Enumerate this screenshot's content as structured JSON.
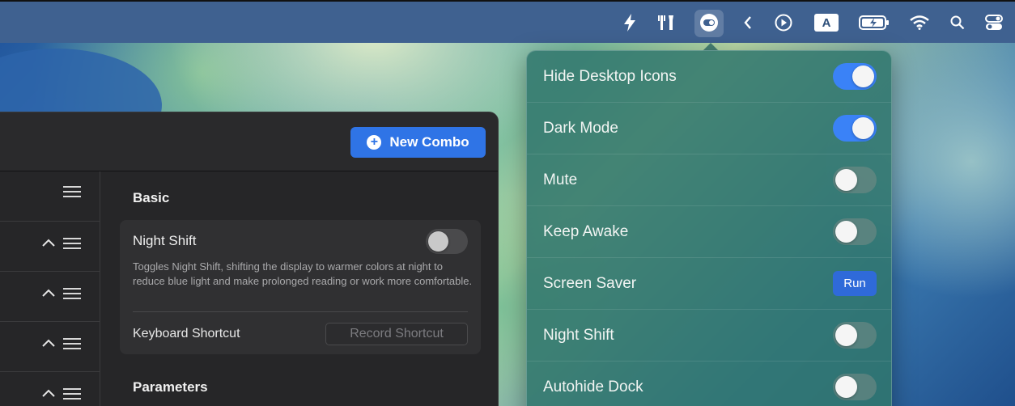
{
  "menubar": {
    "icons": [
      "bolt-icon",
      "tools-icon",
      "toggle-icon",
      "chevron-left-icon",
      "play-circle-icon",
      "input-source-icon",
      "battery-icon",
      "wifi-icon",
      "search-icon",
      "control-center-icon"
    ],
    "input_source_letter": "A"
  },
  "dropdown": {
    "items": [
      {
        "label": "Hide Desktop Icons",
        "control": "toggle",
        "on": true
      },
      {
        "label": "Dark Mode",
        "control": "toggle",
        "on": true
      },
      {
        "label": "Mute",
        "control": "toggle",
        "on": false
      },
      {
        "label": "Keep Awake",
        "control": "toggle",
        "on": false
      },
      {
        "label": "Screen Saver",
        "control": "button",
        "button_label": "Run"
      },
      {
        "label": "Night Shift",
        "control": "toggle",
        "on": false
      },
      {
        "label": "Autohide Dock",
        "control": "toggle",
        "on": false
      }
    ]
  },
  "window": {
    "new_combo_label": "New Combo",
    "basic_title": "Basic",
    "card": {
      "title": "Night Shift",
      "toggle_on": false,
      "description": "Toggles Night Shift, shifting the display to warmer colors at night to reduce blue light and make prolonged reading or work more comfortable.",
      "shortcut_label": "Keyboard Shortcut",
      "record_label": "Record Shortcut"
    },
    "parameters_title": "Parameters"
  },
  "colors": {
    "accent": "#3a82f7",
    "button_blue": "#2f74e6",
    "dropdown_bg": "#30766c",
    "window_bg": "#262628"
  }
}
